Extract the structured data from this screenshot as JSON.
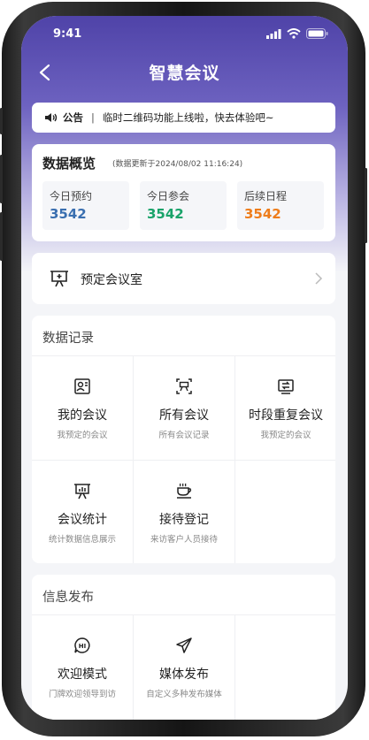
{
  "status_bar": {
    "time": "9:41"
  },
  "nav": {
    "title": "智慧会议"
  },
  "notice": {
    "tag": "公告",
    "separator": "|",
    "text": "临时二维码功能上线啦，快去体验吧~"
  },
  "overview": {
    "title": "数据概览",
    "updated": "(数据更新于2024/08/02 11:16:24)",
    "stats": [
      {
        "label": "今日预约",
        "value": "3542",
        "color": "#3a6fb0"
      },
      {
        "label": "今日参会",
        "value": "3542",
        "color": "#1aa36a"
      },
      {
        "label": "后续日程",
        "value": "3542",
        "color": "#ee7d1b"
      }
    ]
  },
  "book_room": {
    "label": "预定会议室"
  },
  "records": {
    "title": "数据记录",
    "items": [
      {
        "name": "我的会议",
        "desc": "我预定的会议",
        "icon": "user-card-icon"
      },
      {
        "name": "所有会议",
        "desc": "所有会议记录",
        "icon": "meeting-list-icon"
      },
      {
        "name": "时段重复会议",
        "desc": "我预定的会议",
        "icon": "repeat-icon"
      },
      {
        "name": "会议统计",
        "desc": "统计数据信息展示",
        "icon": "chart-board-icon"
      },
      {
        "name": "接待登记",
        "desc": "来访客户人员接待",
        "icon": "coffee-cup-icon"
      }
    ]
  },
  "publish": {
    "title": "信息发布",
    "items": [
      {
        "name": "欢迎模式",
        "desc": "门牌欢迎领导到访",
        "icon": "hi-bubble-icon"
      },
      {
        "name": "媒体发布",
        "desc": "自定义多种发布媒体",
        "icon": "paper-plane-icon"
      }
    ]
  }
}
